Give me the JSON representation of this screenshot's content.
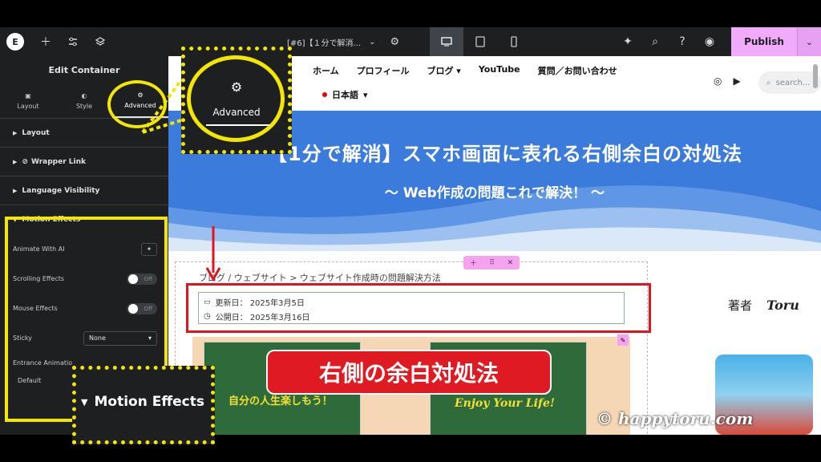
{
  "toolbar": {
    "document_title": "[#6]【１分で解消...",
    "publish_label": "Publish",
    "add_icon": "plus-icon",
    "settings_icon": "sliders-icon",
    "layers_icon": "layers-icon"
  },
  "panel": {
    "title": "Edit Container",
    "tabs": [
      {
        "label": "Layout",
        "icon": "layout-icon"
      },
      {
        "label": "Style",
        "icon": "style-icon"
      },
      {
        "label": "Advanced",
        "icon": "gear-icon"
      }
    ],
    "sections": [
      "Layout",
      "Wrapper Link",
      "Language Visibility",
      "Motion Effects"
    ],
    "motion": {
      "animate_with_ai": "Animate With AI",
      "scrolling_effects": "Scrolling Effects",
      "mouse_effects": "Mouse Effects",
      "toggle_off": "Off",
      "sticky": "Sticky",
      "sticky_value": "None",
      "entrance_animation": "Entrance Animatio",
      "entrance_value": "Default"
    }
  },
  "site": {
    "nav": [
      "ホーム",
      "プロフィール",
      "ブログ",
      "YouTube",
      "質問／お問い合わせ"
    ],
    "language": "日本語",
    "search_placeholder": "search...",
    "hero_title": "【1分で解消】スマホ画面に表れる右側余白の対処法",
    "hero_sub": "～ Web作成の問題これで解決！ ～",
    "breadcrumb": "ブログ / ウェブサイト > ウェブサイト作成時の問題解決方法",
    "updated": "更新日： 2025年3月5日",
    "published": "公開日： 2025年3月16日",
    "author_label": "著者",
    "author_name": "Toru",
    "banner": "右側の余白対処法",
    "card_left_text": "自分の人生楽しもう！",
    "card_right_text": "Enjoy Your Life!",
    "watermark": "© happytoru.com"
  },
  "callouts": {
    "advanced": "Advanced",
    "motion": "Motion Effects"
  },
  "colors": {
    "publish": "#f0abfc",
    "highlight": "#f3e600",
    "alert_red": "#e0141c",
    "hero_blue": "#3b7bdc"
  }
}
